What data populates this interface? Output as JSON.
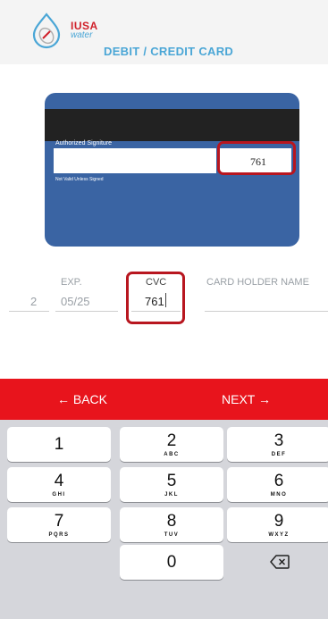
{
  "header": {
    "brand": "IUSA",
    "brand_sub": "water",
    "title": "DEBIT / CREDIT CARD"
  },
  "card": {
    "signature_label": "Authorized Signiture",
    "not_valid_text": "Not Valid Unless Signed",
    "cvc_value": "761"
  },
  "fields": {
    "left_partial": "2",
    "exp_label": "EXP.",
    "exp_value": "05/25",
    "cvc_label": "CVC",
    "cvc_value": "761",
    "holder_label": "CARD HOLDER NAME",
    "holder_value": ""
  },
  "nav": {
    "back": "← BACK",
    "next": "NEXT →"
  },
  "keypad": {
    "k1": {
      "num": "1",
      "letters": ""
    },
    "k2": {
      "num": "2",
      "letters": "ABC"
    },
    "k3": {
      "num": "3",
      "letters": "DEF"
    },
    "k4": {
      "num": "4",
      "letters": "GHI"
    },
    "k5": {
      "num": "5",
      "letters": "JKL"
    },
    "k6": {
      "num": "6",
      "letters": "MNO"
    },
    "k7": {
      "num": "7",
      "letters": "PQRS"
    },
    "k8": {
      "num": "8",
      "letters": "TUV"
    },
    "k9": {
      "num": "9",
      "letters": "WXYZ"
    },
    "k0": {
      "num": "0",
      "letters": ""
    },
    "backspace_icon": "backspace-icon"
  },
  "colors": {
    "accent_red": "#e8141c",
    "card_blue": "#3a64a3",
    "brand_blue": "#4aa6d6",
    "highlight_red": "#b8161f"
  }
}
